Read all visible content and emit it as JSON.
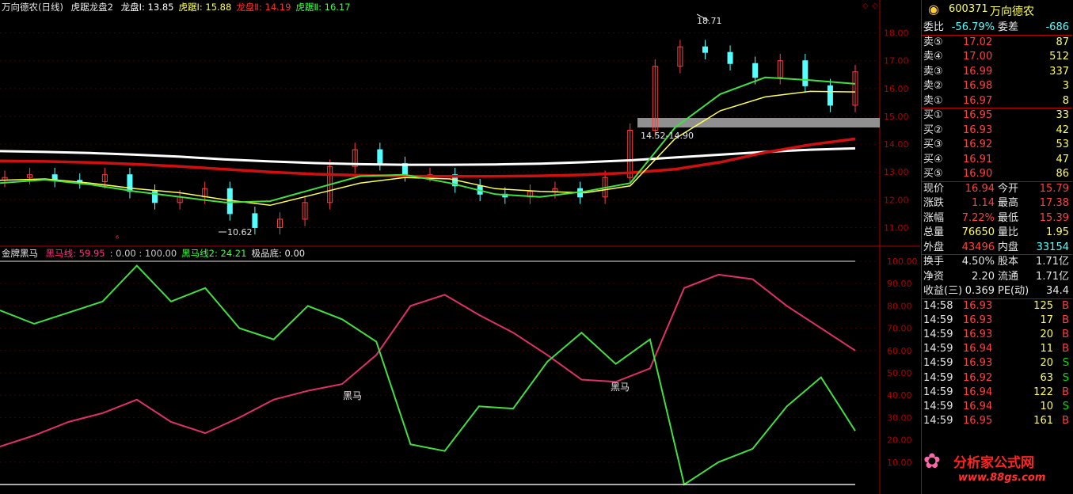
{
  "header": {
    "stock_name": "万向德农(日线)",
    "indicator_name": "虎踞龙盘2",
    "items": [
      {
        "label": "龙盘Ⅰ: 13.85",
        "color": "#ffffff"
      },
      {
        "label": "虎踞Ⅰ: 15.88",
        "color": "#ffff54"
      },
      {
        "label": "龙盘Ⅱ: 14.19",
        "color": "#ff3030"
      },
      {
        "label": "虎踞Ⅱ: 16.17",
        "color": "#40ff40"
      }
    ]
  },
  "indicator_header": {
    "name": "金牌黑马",
    "items": [
      {
        "label": "黑马线: 59.95",
        "color": "#ff3080"
      },
      {
        "label": ": 0.00 : 100.00",
        "color": "#c8c8c8"
      },
      {
        "label": "黑马线2: 24.21",
        "color": "#40ff40"
      },
      {
        "label": "极品底: 0.00",
        "color": "#e6e6e6"
      }
    ]
  },
  "annotations": {
    "high_label": "18.71",
    "low_label": "10.62",
    "zone_label": "14.52-14.90",
    "heima_1": "黑马",
    "heima_2": "黑马"
  },
  "price_axis": [
    "18.00",
    "17.00",
    "16.00",
    "15.00",
    "14.00",
    "13.00",
    "12.00",
    "11.00"
  ],
  "ind_axis": [
    "100.00",
    "90.00",
    "80.00",
    "70.00",
    "60.00",
    "50.00",
    "40.00",
    "30.00",
    "20.00",
    "10.00"
  ],
  "chart_data": [
    {
      "type": "line",
      "title": "万向德农(日线)",
      "y_range": [
        10.5,
        18.9
      ],
      "series": [
        {
          "name": "龙盘Ⅰ",
          "values": [
            13.75,
            13.72,
            13.68,
            13.62,
            13.55,
            13.45,
            13.38,
            13.32,
            13.28,
            13.26,
            13.26,
            13.27,
            13.3,
            13.35,
            13.42,
            13.52,
            13.62,
            13.72,
            13.8,
            13.85
          ]
        },
        {
          "name": "龙盘Ⅱ",
          "values": [
            13.4,
            13.38,
            13.34,
            13.28,
            13.2,
            13.1,
            13.0,
            12.92,
            12.88,
            12.85,
            12.84,
            12.84,
            12.86,
            12.9,
            12.97,
            13.1,
            13.35,
            13.7,
            13.98,
            14.19
          ]
        },
        {
          "name": "虎踞Ⅰ",
          "values": [
            12.7,
            12.75,
            12.6,
            12.4,
            12.25,
            12.0,
            11.8,
            12.2,
            12.6,
            12.8,
            12.75,
            12.4,
            12.3,
            12.25,
            12.5,
            14.2,
            15.2,
            15.7,
            15.9,
            15.88
          ]
        },
        {
          "name": "虎踞Ⅱ",
          "values": [
            12.6,
            12.72,
            12.55,
            12.3,
            12.1,
            11.9,
            11.95,
            12.4,
            12.85,
            12.9,
            12.6,
            12.2,
            12.1,
            12.3,
            12.6,
            14.6,
            15.8,
            16.4,
            16.3,
            16.17
          ]
        }
      ],
      "candles": [
        12.8,
        12.9,
        12.7,
        12.65,
        12.9,
        12.3,
        11.9,
        12.1,
        12.4,
        11.5,
        11.0,
        11.3,
        11.9,
        13.2,
        13.8,
        13.3,
        12.9,
        12.9,
        12.5,
        12.2,
        12.1,
        12.3,
        12.4,
        12.1,
        12.8,
        14.5,
        16.8,
        17.5,
        17.3,
        16.9,
        16.4,
        17.0,
        16.1,
        15.4,
        16.6
      ]
    },
    {
      "type": "line",
      "title": "金牌黑马",
      "y_range": [
        0,
        100
      ],
      "series": [
        {
          "name": "黑马线",
          "values": [
            17,
            22,
            28,
            32,
            38,
            28,
            23,
            30,
            38,
            42,
            45,
            58,
            80,
            85,
            76,
            68,
            58,
            47,
            46,
            52,
            88,
            94,
            92,
            80,
            70,
            60
          ]
        },
        {
          "name": "黑马线2",
          "values": [
            78,
            72,
            77,
            82,
            98,
            82,
            88,
            70,
            65,
            80,
            74,
            64,
            18,
            15,
            35,
            34,
            55,
            68,
            54,
            65,
            0,
            10,
            16,
            35,
            48,
            24
          ]
        }
      ]
    },
    {
      "type": "table",
      "title": "600371 万向德农",
      "quote_rows": [
        {
          "label": "委比",
          "value": "-56.79%",
          "label2": "委差",
          "value2": "-686"
        },
        {
          "label": "卖⑤",
          "value": "17.02",
          "volume": "87"
        },
        {
          "label": "卖④",
          "value": "17.00",
          "volume": "512"
        },
        {
          "label": "卖③",
          "value": "16.99",
          "volume": "337"
        },
        {
          "label": "卖②",
          "value": "16.98",
          "volume": "3"
        },
        {
          "label": "卖①",
          "value": "16.97",
          "volume": "8"
        },
        {
          "label": "买①",
          "value": "16.95",
          "volume": "33"
        },
        {
          "label": "买②",
          "value": "16.93",
          "volume": "42"
        },
        {
          "label": "买③",
          "value": "16.92",
          "volume": "53"
        },
        {
          "label": "买④",
          "value": "16.91",
          "volume": "47"
        },
        {
          "label": "买⑤",
          "value": "16.90",
          "volume": "86"
        }
      ],
      "stats_rows": [
        {
          "l1": "现价",
          "v1": "16.94",
          "l2": "今开",
          "v2": "15.79"
        },
        {
          "l1": "涨跌",
          "v1": "1.14",
          "l2": "最高",
          "v2": "17.38"
        },
        {
          "l1": "涨幅",
          "v1": "7.22%",
          "l2": "最低",
          "v2": "15.39"
        },
        {
          "l1": "总量",
          "v1": "76650",
          "l2": "量比",
          "v2": "1.95"
        },
        {
          "l1": "外盘",
          "v1": "43496",
          "l2": "内盘",
          "v2": "33154"
        }
      ],
      "info_rows": [
        {
          "l1": "换手",
          "v1": "4.50%",
          "l2": "股本",
          "v2": "1.71亿"
        },
        {
          "l1": "净资",
          "v1": "2.20",
          "l2": "流通",
          "v2": "1.71亿"
        },
        {
          "l1": "收益(三)",
          "v1": "0.369",
          "l2": "PE(动)",
          "v2": "34.4"
        }
      ],
      "ticks": [
        {
          "time": "14:58",
          "price": "16.93",
          "vol": "125",
          "side": "B"
        },
        {
          "time": "14:59",
          "price": "16.93",
          "vol": "17",
          "side": "B"
        },
        {
          "time": "14:59",
          "price": "16.93",
          "vol": "20",
          "side": "B"
        },
        {
          "time": "14:59",
          "price": "16.94",
          "vol": "11",
          "side": "B"
        },
        {
          "time": "14:59",
          "price": "16.93",
          "vol": "20",
          "side": "S"
        },
        {
          "time": "14:59",
          "price": "16.92",
          "vol": "63",
          "side": "S"
        },
        {
          "time": "14:59",
          "price": "16.94",
          "vol": "122",
          "side": "B"
        },
        {
          "time": "14:59",
          "price": "16.94",
          "vol": "10",
          "side": "S"
        },
        {
          "time": "14:59",
          "price": "16.95",
          "vol": "161",
          "side": "B"
        }
      ]
    }
  ],
  "panel_title": {
    "code": "600371",
    "name": "万向德农"
  },
  "watermark": {
    "text": "分析家公式网",
    "url": "www.88gs.com"
  }
}
